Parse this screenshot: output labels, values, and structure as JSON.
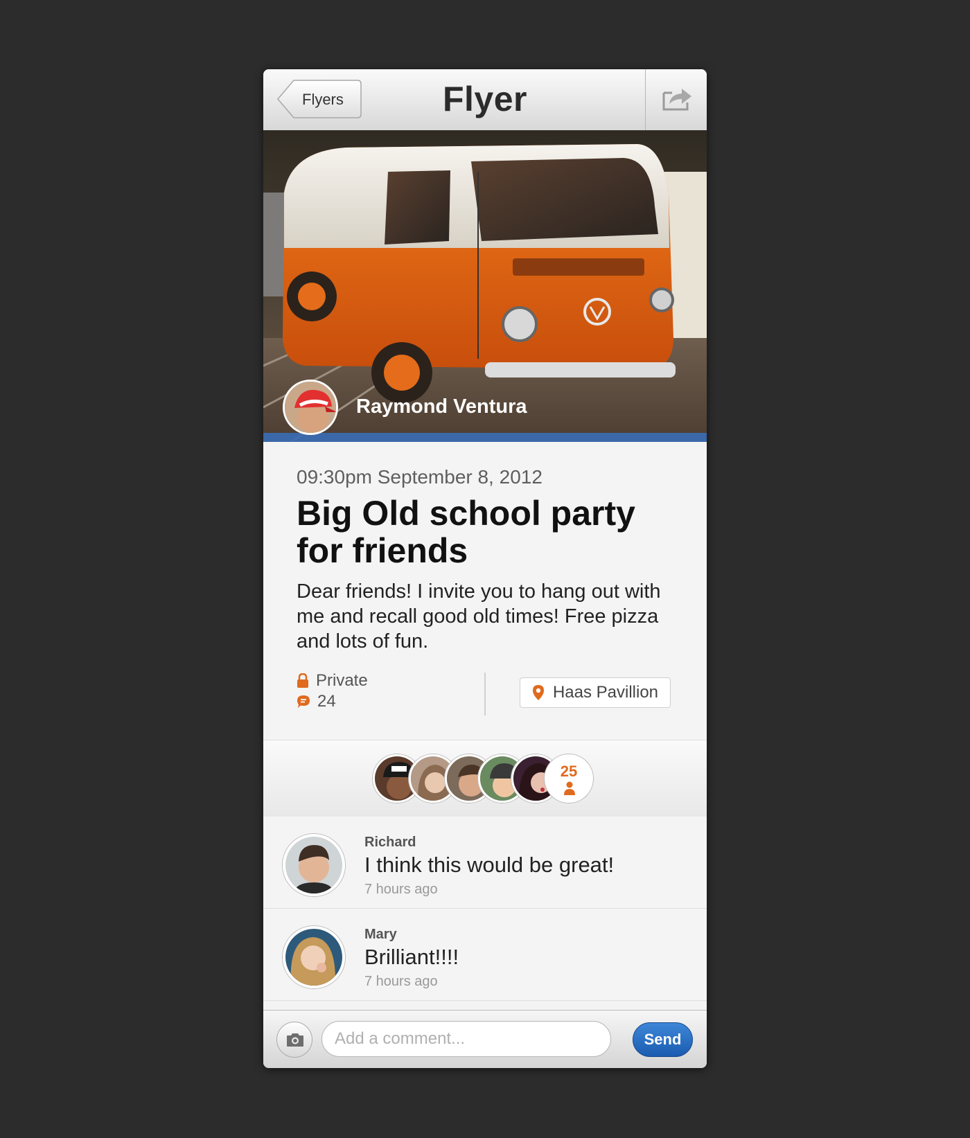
{
  "navbar": {
    "back_label": "Flyers",
    "title": "Flyer"
  },
  "post": {
    "author": "Raymond Ventura",
    "datetime": "09:30pm September 8, 2012",
    "title": "Big Old school party for friends",
    "body": "Dear friends! I invite you to hang out with me and recall good old times! Free pizza and lots of fun.",
    "privacy": "Private",
    "comment_count": "24",
    "location": "Haas Pavillion"
  },
  "attendees": {
    "count": "25"
  },
  "comments": [
    {
      "name": "Richard",
      "text": "I think this would be great!",
      "time": "7 hours ago"
    },
    {
      "name": "Mary",
      "text": "Brilliant!!!!",
      "time": "7 hours ago"
    }
  ],
  "composer": {
    "placeholder": "Add a comment...",
    "send_label": "Send"
  },
  "colors": {
    "accent_orange": "#e06a1e",
    "author_bar_blue": "#3a6cb2",
    "send_blue": "#1a5cb0",
    "background": "#2c2c2c"
  },
  "icons": [
    "back-chevron-icon",
    "share-icon",
    "lock-icon",
    "comment-bubble-icon",
    "location-pin-icon",
    "person-icon",
    "camera-icon"
  ]
}
